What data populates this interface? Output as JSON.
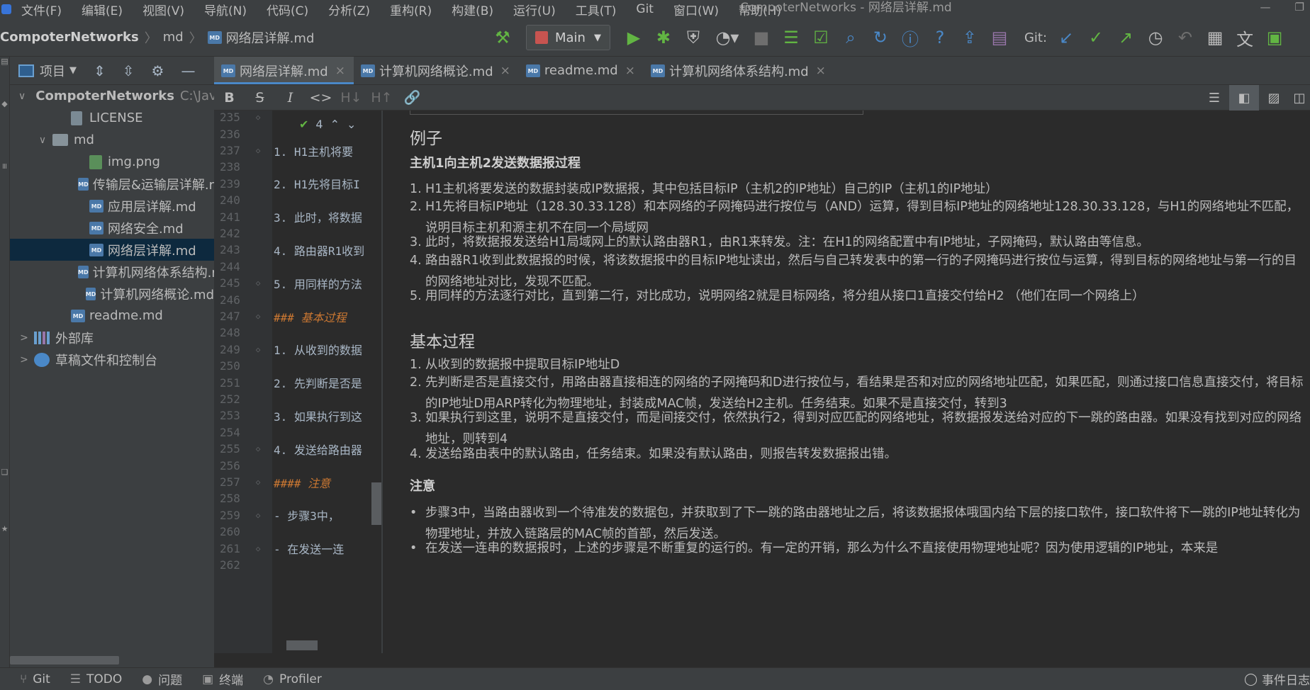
{
  "menu": [
    "文件(F)",
    "编辑(E)",
    "视图(V)",
    "导航(N)",
    "代码(C)",
    "分析(Z)",
    "重构(R)",
    "构建(B)",
    "运行(U)",
    "工具(T)",
    "Git",
    "窗口(W)",
    "帮助(H)"
  ],
  "window_title": "CompoterNetworks - 网络层详解.md",
  "breadcrumb": {
    "project": "CompoterNetworks",
    "folder": "md",
    "file": "网络层详解.md"
  },
  "run_config": "Main",
  "git_label": "Git:",
  "project_panel": {
    "title": "项目"
  },
  "tree": [
    {
      "label": "CompoterNetworks",
      "extra": "C:\\Jav",
      "type": "project",
      "depth": 0,
      "arrow": "∨"
    },
    {
      "label": "LICENSE",
      "type": "file",
      "depth": 2,
      "arrow": ""
    },
    {
      "label": "md",
      "type": "folder",
      "depth": 1,
      "arrow": "∨"
    },
    {
      "label": "img.png",
      "type": "img",
      "depth": 3,
      "arrow": ""
    },
    {
      "label": "传输层&运输层详解.r",
      "type": "md",
      "depth": 3,
      "arrow": ""
    },
    {
      "label": "应用层详解.md",
      "type": "md",
      "depth": 3,
      "arrow": ""
    },
    {
      "label": "网络安全.md",
      "type": "md",
      "depth": 3,
      "arrow": ""
    },
    {
      "label": "网络层详解.md",
      "type": "md",
      "depth": 3,
      "arrow": "",
      "selected": true
    },
    {
      "label": "计算机网络体系结构.r",
      "type": "md",
      "depth": 3,
      "arrow": ""
    },
    {
      "label": "计算机网络概论.md",
      "type": "md",
      "depth": 3,
      "arrow": ""
    },
    {
      "label": "readme.md",
      "type": "md",
      "depth": 2,
      "arrow": ""
    },
    {
      "label": "外部库",
      "type": "lib",
      "depth": 0,
      "arrow": ">"
    },
    {
      "label": "草稿文件和控制台",
      "type": "scratch",
      "depth": 0,
      "arrow": ">"
    }
  ],
  "tabs": [
    {
      "label": "网络层详解.md",
      "active": true
    },
    {
      "label": "计算机网络概论.md",
      "active": false
    },
    {
      "label": "readme.md",
      "active": false
    },
    {
      "label": "计算机网络体系结构.md",
      "active": false
    }
  ],
  "md_toolbar": [
    "B",
    "S",
    "I",
    "<>",
    "H↓",
    "H↑",
    "🔗"
  ],
  "inspection": {
    "count": "4"
  },
  "code_lines": [
    {
      "n": "235",
      "text": "",
      "fold": "⌂"
    },
    {
      "n": "236",
      "text": ""
    },
    {
      "n": "237",
      "text": "1. H1主机将要",
      "fold": "⌂"
    },
    {
      "n": "238",
      "text": ""
    },
    {
      "n": "239",
      "text": "2. H1先将目标I"
    },
    {
      "n": "240",
      "text": ""
    },
    {
      "n": "241",
      "text": "3. 此时，将数据"
    },
    {
      "n": "242",
      "text": ""
    },
    {
      "n": "243",
      "text": "4. 路由器R1收到"
    },
    {
      "n": "244",
      "text": ""
    },
    {
      "n": "245",
      "text": "5. 用同样的方法",
      "fold": "⌂"
    },
    {
      "n": "246",
      "text": ""
    },
    {
      "n": "247",
      "text": "### 基本过程",
      "fold": "⌂",
      "head": true
    },
    {
      "n": "248",
      "text": ""
    },
    {
      "n": "249",
      "text": "1. 从收到的数据",
      "fold": "⌂"
    },
    {
      "n": "250",
      "text": ""
    },
    {
      "n": "251",
      "text": "2. 先判断是否是"
    },
    {
      "n": "252",
      "text": ""
    },
    {
      "n": "253",
      "text": "3. 如果执行到这"
    },
    {
      "n": "254",
      "text": ""
    },
    {
      "n": "255",
      "text": "4. 发送给路由器",
      "fold": "⌂"
    },
    {
      "n": "256",
      "text": ""
    },
    {
      "n": "257",
      "text": "#### 注意",
      "fold": "⌂",
      "head": true
    },
    {
      "n": "258",
      "text": ""
    },
    {
      "n": "259",
      "text": "  - 步骤3中，",
      "fold": "⌂"
    },
    {
      "n": "260",
      "text": ""
    },
    {
      "n": "261",
      "text": "  - 在发送一连",
      "fold": "⌂"
    },
    {
      "n": "262",
      "text": ""
    }
  ],
  "preview": {
    "example_heading": "例子",
    "example_sub": "主机1向主机2发送数据报过程",
    "example_items": [
      "H1主机将要发送的数据封装成IP数据报，其中包括目标IP（主机2的IP地址）自己的IP（主机1的IP地址）",
      "H1先将目标IP地址（128.30.33.128）和本网络的子网掩码进行按位与（AND）运算，得到目标IP地址的网络地址128.30.33.128，与H1的网络地址不匹配，说明目标主机和源主机不在同一个局域网",
      "此时，将数据报发送给H1局域网上的默认路由器R1，由R1来转发。注：在H1的网络配置中有IP地址，子网掩码，默认路由等信息。",
      "路由器R1收到此数据报的时候，将该数据报中的目标IP地址读出，然后与自己转发表中的第一行的子网掩码进行按位与运算，得到目标的网络地址与第一行的目的网络地址对比，发现不匹配。",
      "用同样的方法逐行对比，直到第二行，对比成功，说明网络2就是目标网络，将分组从接口1直接交付给H2 （他们在同一个网络上）"
    ],
    "basic_heading": "基本过程",
    "basic_items": [
      "从收到的数据报中提取目标IP地址D",
      "先判断是否是直接交付，用路由器直接相连的网络的子网掩码和D进行按位与，看结果是否和对应的网络地址匹配，如果匹配，则通过接口信息直接交付，将目标的IP地址D用ARP转化为物理地址，封装成MAC帧，发送给H2主机。任务结束。如果不是直接交付，转到3",
      "如果执行到这里，说明不是直接交付，而是间接交付，依然执行2，得到对应匹配的网络地址，将数据报发送给对应的下一跳的路由器。如果没有找到对应的网络地址，则转到4",
      "发送给路由表中的默认路由，任务结束。如果没有默认路由，则报告转发数据报出错。"
    ],
    "note_heading": "注意",
    "note_items": [
      "步骤3中，当路由器收到一个待准发的数据包，并获取到了下一跳的路由器地址之后，将该数据报体哦国内给下层的接口软件，接口软件将下一跳的IP地址转化为物理地址，并放入链路层的MAC帧的首部，然后发送。",
      "在发送一连串的数据报时，上述的步骤是不断重复的运行的。有一定的开销，那么为什么不直接使用物理地址呢？因为使用逻辑的IP地址，本来是"
    ]
  },
  "statusbar": [
    {
      "icon": "⑂",
      "label": "Git"
    },
    {
      "icon": "☰",
      "label": "TODO"
    },
    {
      "icon": "●",
      "label": "问题"
    },
    {
      "icon": "▣",
      "label": "终端"
    },
    {
      "icon": "◔",
      "label": "Profiler"
    }
  ],
  "status_right": "事件日志"
}
